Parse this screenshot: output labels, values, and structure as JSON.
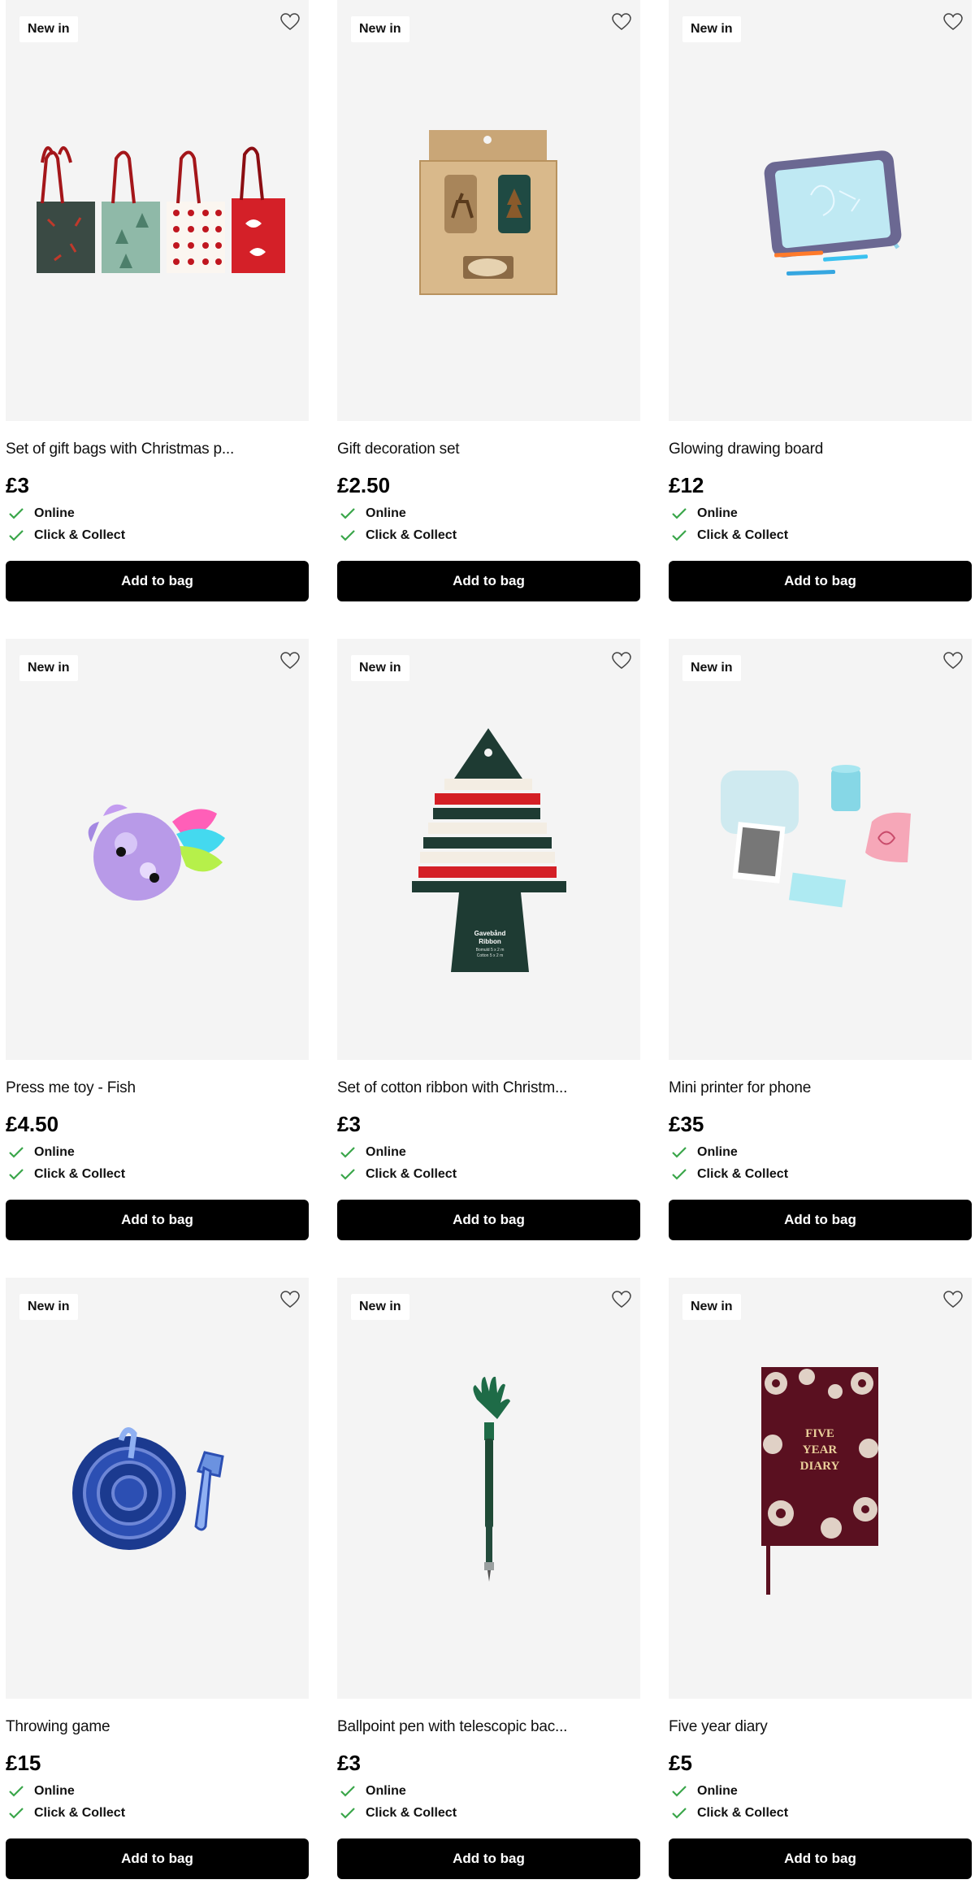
{
  "products": [
    {
      "badge": "New in",
      "title": "Set of gift bags with Christmas p...",
      "price": "£3",
      "availability": [
        "Online",
        "Click & Collect"
      ],
      "cta": "Add to bag",
      "image": "gift-bags-image"
    },
    {
      "badge": "New in",
      "title": "Gift decoration set",
      "price": "£2.50",
      "availability": [
        "Online",
        "Click & Collect"
      ],
      "cta": "Add to bag",
      "image": "gift-decoration-set-image"
    },
    {
      "badge": "New in",
      "title": "Glowing drawing board",
      "price": "£12",
      "availability": [
        "Online",
        "Click & Collect"
      ],
      "cta": "Add to bag",
      "image": "drawing-board-image"
    },
    {
      "badge": "New in",
      "title": "Press me toy - Fish",
      "price": "£4.50",
      "availability": [
        "Online",
        "Click & Collect"
      ],
      "cta": "Add to bag",
      "image": "fish-toy-image"
    },
    {
      "badge": "New in",
      "title": "Set of cotton ribbon with Christm...",
      "price": "£3",
      "availability": [
        "Online",
        "Click & Collect"
      ],
      "cta": "Add to bag",
      "image": "ribbon-tree-image",
      "image_text": [
        "Gavebånd",
        "Ribbon",
        "Bomuld 5 x 2 m",
        "Cotton 5 x 2 m"
      ]
    },
    {
      "badge": "New in",
      "title": "Mini printer for phone",
      "price": "£35",
      "availability": [
        "Online",
        "Click & Collect"
      ],
      "cta": "Add to bag",
      "image": "mini-printer-image"
    },
    {
      "badge": "New in",
      "title": "Throwing game",
      "price": "£15",
      "availability": [
        "Online",
        "Click & Collect"
      ],
      "cta": "Add to bag",
      "image": "throwing-game-image"
    },
    {
      "badge": "New in",
      "title": "Ballpoint pen with telescopic bac...",
      "price": "£3",
      "availability": [
        "Online",
        "Click & Collect"
      ],
      "cta": "Add to bag",
      "image": "back-scratcher-pen-image"
    },
    {
      "badge": "New in",
      "title": "Five year diary",
      "price": "£5",
      "availability": [
        "Online",
        "Click & Collect"
      ],
      "cta": "Add to bag",
      "image": "five-year-diary-image",
      "image_text": [
        "FIVE",
        "YEAR",
        "DIARY"
      ]
    }
  ],
  "icons": {
    "favourite": "heart-outline-icon",
    "available": "checkmark-icon"
  },
  "colors": {
    "button_bg": "#000000",
    "button_text": "#ffffff",
    "check": "#3aa64a",
    "media_bg": "#f4f4f4"
  }
}
